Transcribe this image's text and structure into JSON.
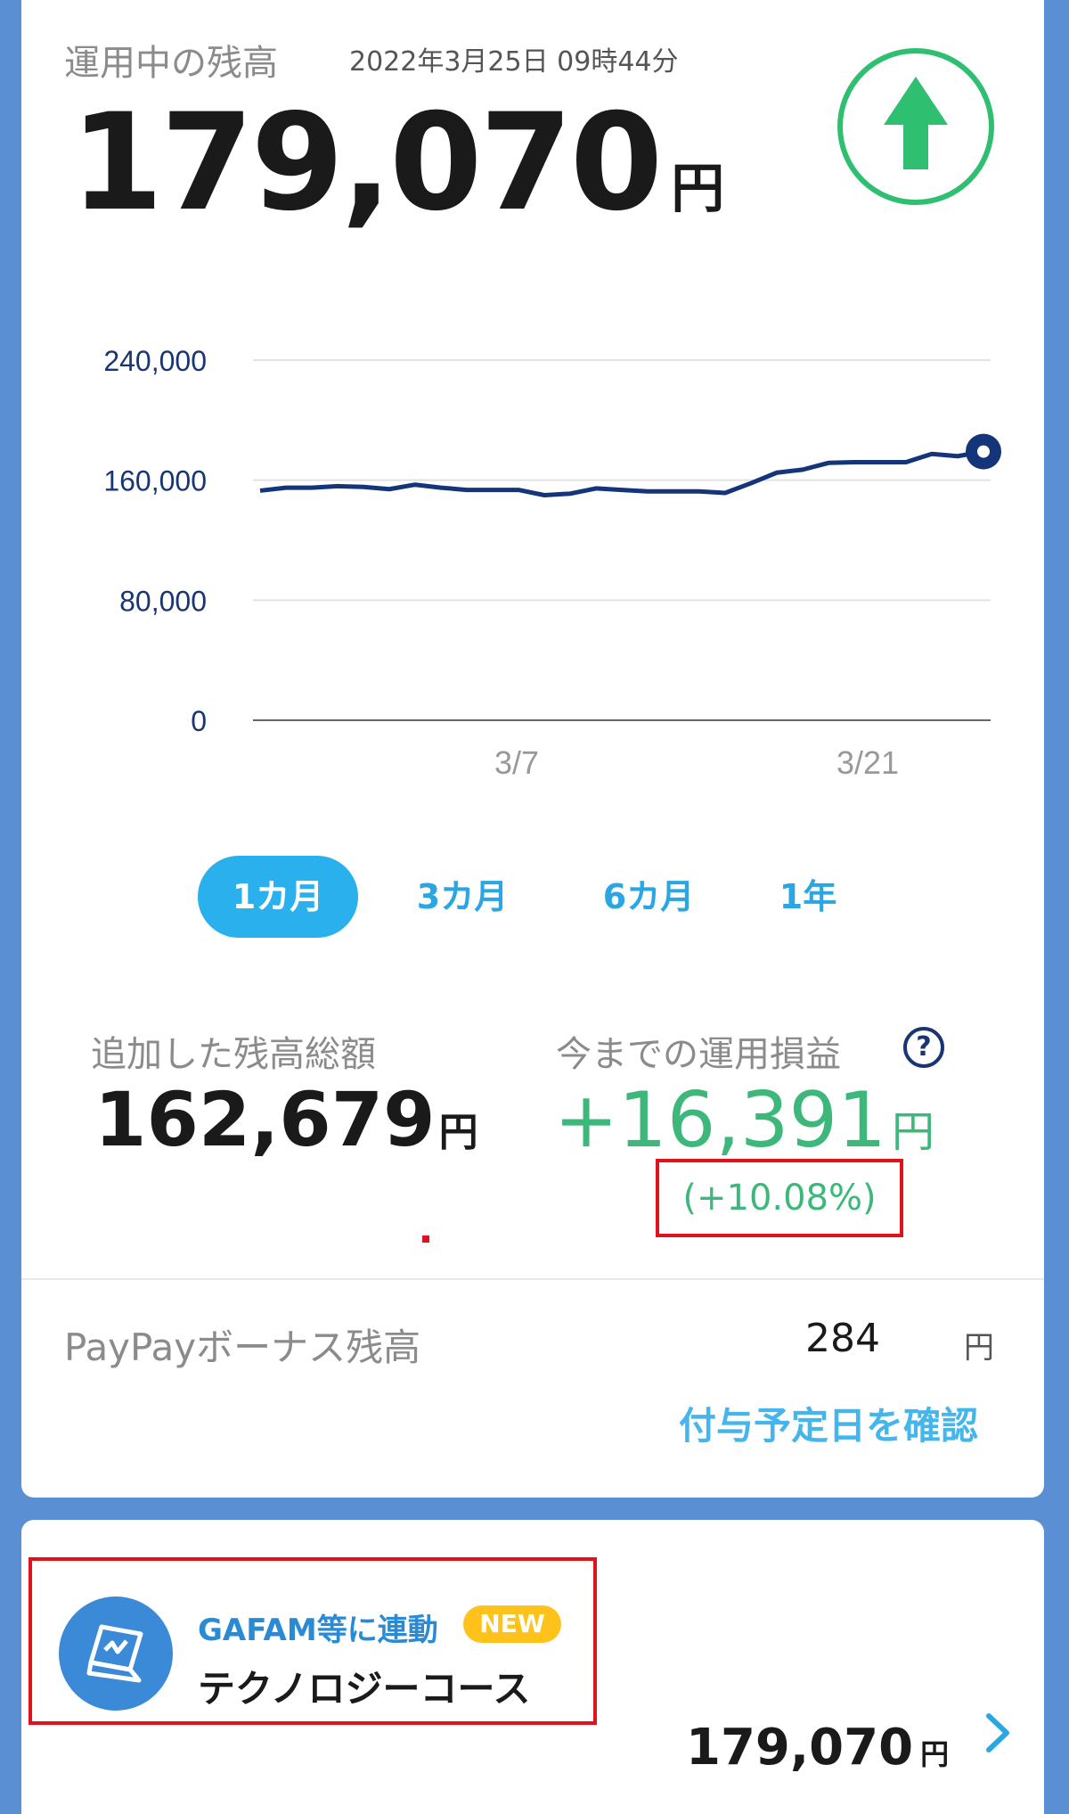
{
  "header": {
    "title": "運用中の残高",
    "timestamp": "2022年3月25日 09時44分",
    "balance": "179,070",
    "unit": "円"
  },
  "trend": {
    "direction": "up",
    "icon": "up-arrow-icon",
    "color": "#2fbf71"
  },
  "chart_data": {
    "type": "line",
    "y_ticks": [
      "240,000",
      "160,000",
      "80,000",
      "0"
    ],
    "x_ticks": [
      "3/7",
      "3/21"
    ],
    "ylim": [
      0,
      240000
    ],
    "grid": true,
    "values": [
      153000,
      155000,
      155000,
      156000,
      155500,
      154000,
      157000,
      155000,
      153500,
      153500,
      153500,
      150000,
      151000,
      154500,
      153500,
      152500,
      152500,
      152500,
      151500,
      158000,
      165000,
      167000,
      171500,
      172000,
      172000,
      172000,
      177500,
      176000,
      179070
    ],
    "line_color": "#14357a"
  },
  "period_tabs": [
    {
      "label": "1カ月",
      "active": true
    },
    {
      "label": "3カ月",
      "active": false
    },
    {
      "label": "6カ月",
      "active": false
    },
    {
      "label": "1年",
      "active": false
    }
  ],
  "stats": {
    "added_label": "追加した残高総額",
    "added_value": "162,679",
    "added_unit": "円",
    "profit_label": "今までの運用損益",
    "profit_value": "+16,391",
    "profit_unit": "円",
    "profit_pct": "(+10.08%)",
    "help_icon": "?"
  },
  "bonus": {
    "label": "PayPayボーナス残高",
    "value": "284",
    "unit": "円",
    "link": "付与予定日を確認"
  },
  "course": {
    "tag": "GAFAM等に連動",
    "badge": "NEW",
    "name": "テクノロジーコース",
    "balance": "179,070",
    "unit": "円",
    "icon": "laptop-icon"
  }
}
